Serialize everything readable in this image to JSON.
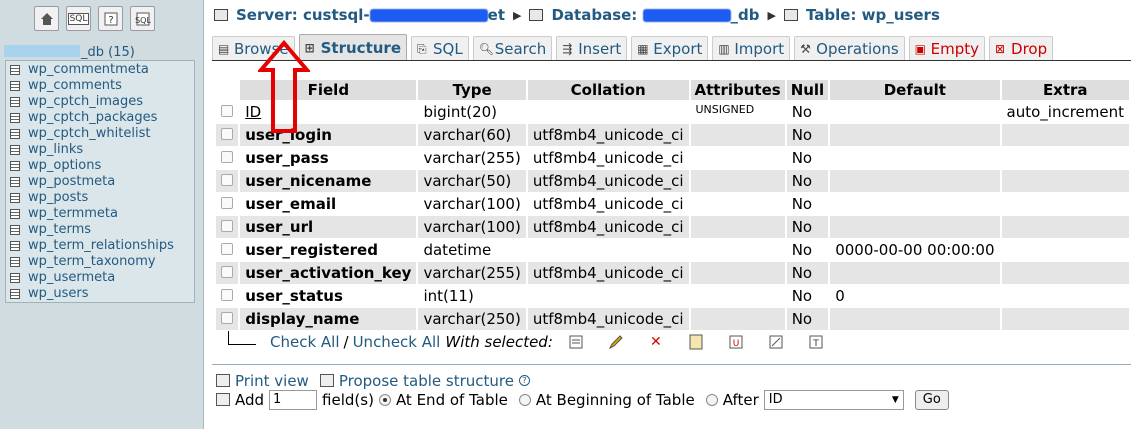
{
  "left": {
    "db_name": "_db (15)",
    "icons": [
      {
        "name": "home-icon"
      },
      {
        "name": "sql-icon",
        "text": "SQL"
      },
      {
        "name": "query-window-icon"
      },
      {
        "name": "docs-icon"
      }
    ],
    "tables": [
      {
        "label": "wp_commentmeta"
      },
      {
        "label": "wp_comments"
      },
      {
        "label": "wp_cptch_images"
      },
      {
        "label": "wp_cptch_packages"
      },
      {
        "label": "wp_cptch_whitelist"
      },
      {
        "label": "wp_links"
      },
      {
        "label": "wp_options"
      },
      {
        "label": "wp_postmeta"
      },
      {
        "label": "wp_posts"
      },
      {
        "label": "wp_termmeta"
      },
      {
        "label": "wp_terms"
      },
      {
        "label": "wp_term_relationships"
      },
      {
        "label": "wp_term_taxonomy"
      },
      {
        "label": "wp_usermeta"
      },
      {
        "label": "wp_users"
      }
    ]
  },
  "breadcrumb": {
    "server_label": "Server: custsql-",
    "server_suffix": "et",
    "database_label": "Database:",
    "database_suffix": "_db",
    "table_label": "Table: wp_users"
  },
  "tabs": [
    {
      "label": "Browse",
      "icon": "browse-icon"
    },
    {
      "label": "Structure",
      "icon": "structure-icon",
      "active": true
    },
    {
      "label": "SQL",
      "icon": "sql-icon"
    },
    {
      "label": "Search",
      "icon": "search-icon"
    },
    {
      "label": "Insert",
      "icon": "insert-icon"
    },
    {
      "label": "Export",
      "icon": "export-icon"
    },
    {
      "label": "Import",
      "icon": "import-icon"
    },
    {
      "label": "Operations",
      "icon": "operations-icon"
    },
    {
      "label": "Empty",
      "icon": "empty-icon",
      "danger": true
    },
    {
      "label": "Drop",
      "icon": "drop-icon",
      "danger": true
    }
  ],
  "table": {
    "headers": [
      "Field",
      "Type",
      "Collation",
      "Attributes",
      "Null",
      "Default",
      "Extra"
    ],
    "rows": [
      {
        "field": "ID",
        "type": "bigint(20)",
        "collation": "",
        "attributes": "UNSIGNED",
        "null": "No",
        "default": "",
        "extra": "auto_increment",
        "key": true
      },
      {
        "field": "user_login",
        "type": "varchar(60)",
        "collation": "utf8mb4_unicode_ci",
        "attributes": "",
        "null": "No",
        "default": "",
        "extra": ""
      },
      {
        "field": "user_pass",
        "type": "varchar(255)",
        "collation": "utf8mb4_unicode_ci",
        "attributes": "",
        "null": "No",
        "default": "",
        "extra": ""
      },
      {
        "field": "user_nicename",
        "type": "varchar(50)",
        "collation": "utf8mb4_unicode_ci",
        "attributes": "",
        "null": "No",
        "default": "",
        "extra": ""
      },
      {
        "field": "user_email",
        "type": "varchar(100)",
        "collation": "utf8mb4_unicode_ci",
        "attributes": "",
        "null": "No",
        "default": "",
        "extra": ""
      },
      {
        "field": "user_url",
        "type": "varchar(100)",
        "collation": "utf8mb4_unicode_ci",
        "attributes": "",
        "null": "No",
        "default": "",
        "extra": ""
      },
      {
        "field": "user_registered",
        "type": "datetime",
        "collation": "",
        "attributes": "",
        "null": "No",
        "default": "0000-00-00 00:00:00",
        "extra": ""
      },
      {
        "field": "user_activation_key",
        "type": "varchar(255)",
        "collation": "utf8mb4_unicode_ci",
        "attributes": "",
        "null": "No",
        "default": "",
        "extra": ""
      },
      {
        "field": "user_status",
        "type": "int(11)",
        "collation": "",
        "attributes": "",
        "null": "No",
        "default": "0",
        "extra": ""
      },
      {
        "field": "display_name",
        "type": "varchar(250)",
        "collation": "utf8mb4_unicode_ci",
        "attributes": "",
        "null": "No",
        "default": "",
        "extra": ""
      }
    ]
  },
  "with_selected": {
    "check_all": "Check All",
    "separator": "/",
    "uncheck_all": "Uncheck All",
    "label": "With selected:"
  },
  "bottom": {
    "print_view": "Print view",
    "propose": "Propose table structure",
    "help": "?",
    "add_label": "Add",
    "add_value": "1",
    "fields_label": "field(s)",
    "opt_end": "At End of Table",
    "opt_begin": "At Beginning of Table",
    "opt_after": "After",
    "after_select": "ID",
    "go": "Go"
  },
  "overlay": {
    "arrow_color": "#e60000"
  }
}
